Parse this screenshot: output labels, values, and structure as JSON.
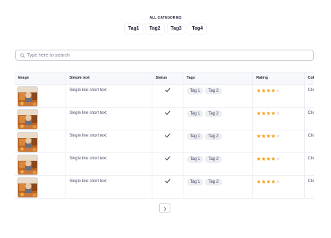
{
  "categories": {
    "title": "ALL CATEGORIES",
    "tags": [
      "Tag1",
      "Tag2",
      "Tag3",
      "Tag4"
    ]
  },
  "search": {
    "placeholder": "Type here to search",
    "icon": "search-icon"
  },
  "table": {
    "columns": [
      "Image",
      "Simple text",
      "Status",
      "Tags",
      "Rating",
      "Col"
    ],
    "rows": [
      {
        "text": "Single line short text",
        "status": "checkmark-icon",
        "tags": [
          "Tag 1",
          "Tag 2"
        ],
        "rating": 4,
        "rating_max": 5,
        "col": "Clic"
      },
      {
        "text": "Single line short text",
        "status": "checkmark-icon",
        "tags": [
          "Tag 1",
          "Tag 2"
        ],
        "rating": 4,
        "rating_max": 5,
        "col": "Clic"
      },
      {
        "text": "Single line short text",
        "status": "checkmark-icon",
        "tags": [
          "Tag 1",
          "Tag 2"
        ],
        "rating": 4,
        "rating_max": 5,
        "col": "Clic"
      },
      {
        "text": "Single line short text",
        "status": "checkmark-icon",
        "tags": [
          "Tag 1",
          "Tag 2"
        ],
        "rating": 4,
        "rating_max": 5,
        "col": "Clic"
      },
      {
        "text": "Single line short text",
        "status": "checkmark-icon",
        "tags": [
          "Tag 1",
          "Tag 2"
        ],
        "rating": 4,
        "rating_max": 5,
        "col": "Clic"
      }
    ]
  },
  "pagination": {
    "next_icon": "chevron-right-icon"
  },
  "colors": {
    "star_filled": "#f5a623",
    "star_empty": "#e3e4ea",
    "border": "#eceef3",
    "header_bg": "#f7f8fb"
  }
}
